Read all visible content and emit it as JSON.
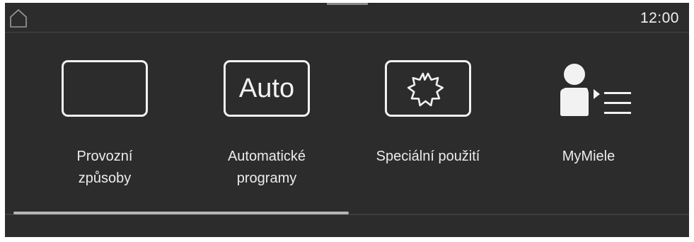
{
  "status_bar": {
    "home_icon": "home-icon",
    "time": "12:00"
  },
  "tiles": [
    {
      "icon": "operating-modes-frame-icon",
      "label": "Provozní\nzpůsoby"
    },
    {
      "icon": "auto-icon",
      "icon_text": "Auto",
      "label": "Automatické\nprogramy"
    },
    {
      "icon": "special-applications-star-icon",
      "label": "Speciální použití"
    },
    {
      "icon": "mymiele-user-list-icon",
      "label": "MyMiele"
    }
  ],
  "scrollbar": {
    "position": 0,
    "visible_fraction": 0.49
  },
  "colors": {
    "background": "#2c2c2c",
    "foreground": "#f2f2f2",
    "scroll_thumb": "#b5b5b5"
  }
}
